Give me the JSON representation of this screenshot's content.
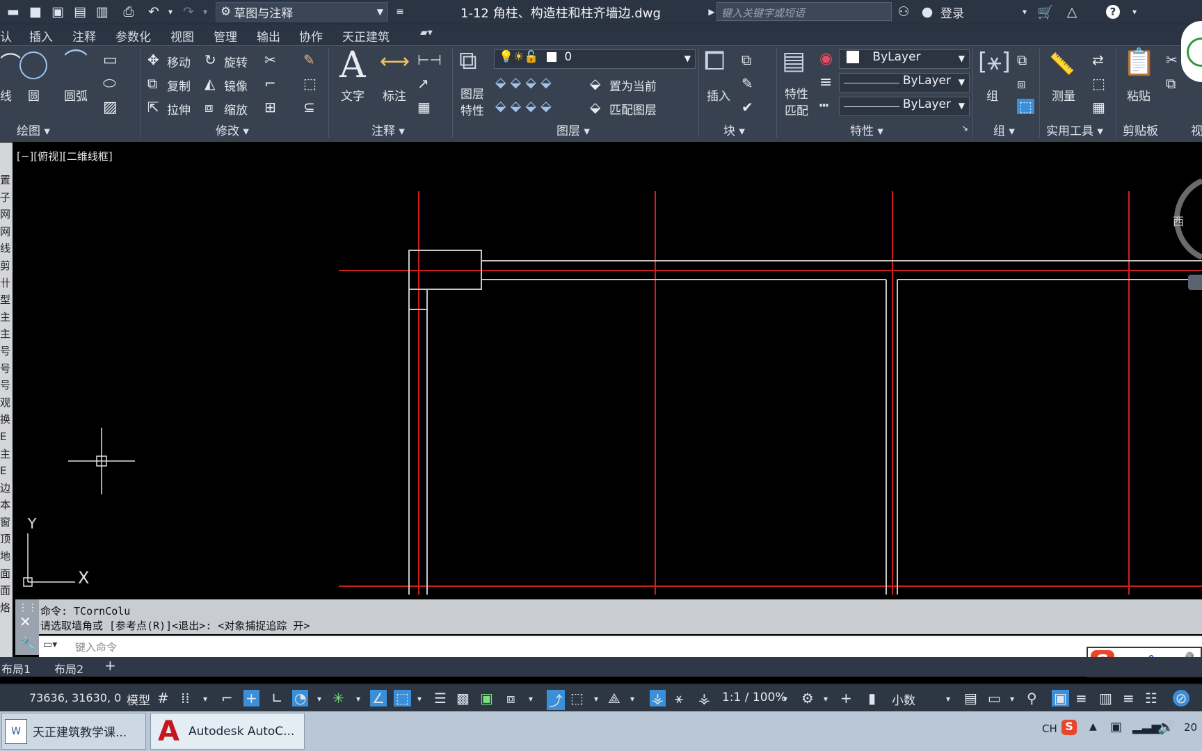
{
  "titlebar": {
    "workspace": "草图与注释",
    "filename": "1-12 角柱、构造柱和柱齐墙边.dwg",
    "search_placeholder": "键入关键字或短语",
    "login": "登录"
  },
  "menu_tabs": [
    "认",
    "插入",
    "注释",
    "参数化",
    "视图",
    "管理",
    "输出",
    "协作",
    "天正建筑"
  ],
  "ribbon": {
    "draw": {
      "items": [
        "线",
        "圆",
        "圆弧"
      ],
      "footer": "绘图"
    },
    "modify": {
      "items": [
        "移动",
        "旋转",
        "复制",
        "镜像",
        "拉伸",
        "缩放"
      ],
      "footer": "修改"
    },
    "annotation": {
      "items": [
        "文字",
        "标注"
      ],
      "footer": "注释"
    },
    "layers": {
      "items": [
        "图层\n特性",
        "置为当前",
        "匹配图层"
      ],
      "current_layer": "0",
      "footer": "图层"
    },
    "block": {
      "items": [
        "插入"
      ],
      "footer": "块"
    },
    "properties": {
      "items": [
        "特性\n匹配"
      ],
      "color": "ByLayer",
      "linetype": "ByLayer",
      "lineweight": "ByLayer",
      "footer": "特性"
    },
    "groups": {
      "items": [
        "组"
      ],
      "footer": "组"
    },
    "utilities": {
      "items": [
        "测量"
      ],
      "footer": "实用工具"
    },
    "clipboard": {
      "items": [
        "粘贴"
      ],
      "footer": "剪贴板"
    },
    "view_cut": "视"
  },
  "viewport": {
    "view_label": "[−][俯视][二维线框]",
    "compass_label": "西",
    "ucs_x": "X",
    "ucs_y": "Y"
  },
  "left_strip": [
    "置",
    "子",
    "网",
    "网",
    "线",
    "剪",
    "卄",
    "型",
    "主",
    "主",
    "号",
    "号",
    "号",
    "观",
    "换",
    "E",
    "主",
    "E",
    "边",
    "本",
    "窗",
    "顶",
    "地",
    "面",
    "面",
    "烙"
  ],
  "command": {
    "line1": "命令: TCornColu",
    "line2": "请选取墙角或 [参考点(R)]<退出>: <对象捕捉追踪 开>",
    "placeholder": "键入命令"
  },
  "layout_tabs": [
    "布局1",
    "布局2",
    "+"
  ],
  "statusbar": {
    "coords": "73636, 31630, 0",
    "model": "模型",
    "scale": "1:1 / 100%",
    "units": "小数"
  },
  "taskbar": {
    "items": [
      "天正建筑教学课...",
      "Autodesk AutoC..."
    ],
    "tray_lang": "CH",
    "tray_clock_cut": "20"
  },
  "ime": {
    "label": "中",
    "punct": "°,"
  },
  "colors": {
    "axis_red": "#d0201e",
    "wall_gray": "#c8c8c8",
    "ribbon_bg": "#38414f",
    "accent_blue": "#3a8fd8"
  }
}
